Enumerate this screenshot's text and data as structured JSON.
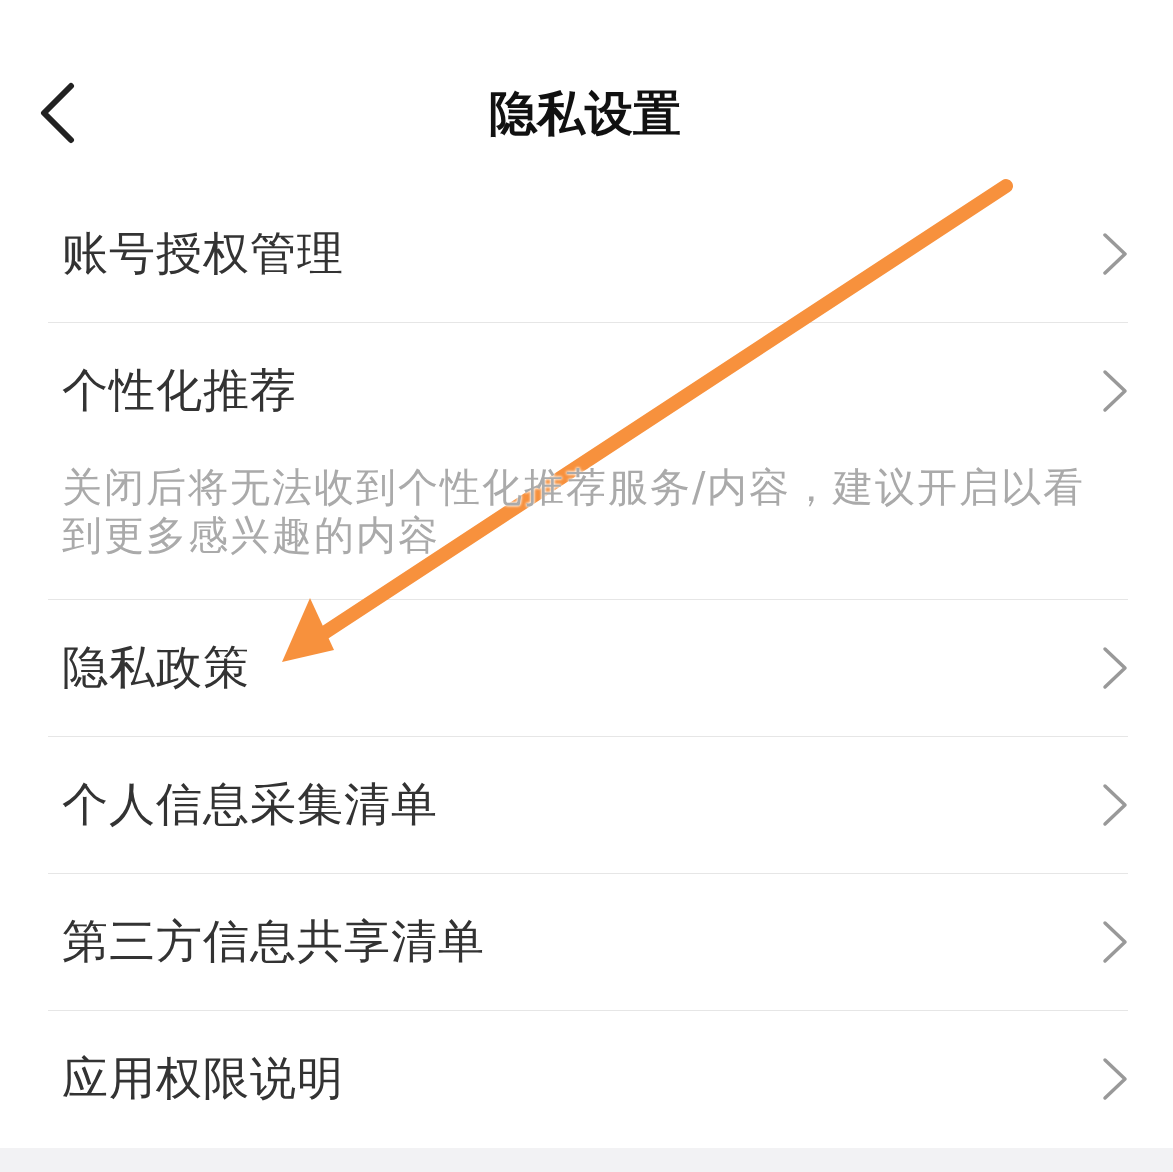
{
  "header": {
    "title": "隐私设置"
  },
  "items": [
    {
      "label": "账号授权管理"
    },
    {
      "label": "个性化推荐",
      "description": "关闭后将无法收到个性化推荐服务/内容，建议开启以看到更多感兴趣的内容"
    },
    {
      "label": "隐私政策"
    },
    {
      "label": "个人信息采集清单"
    },
    {
      "label": "第三方信息共享清单"
    },
    {
      "label": "应用权限说明"
    }
  ]
}
